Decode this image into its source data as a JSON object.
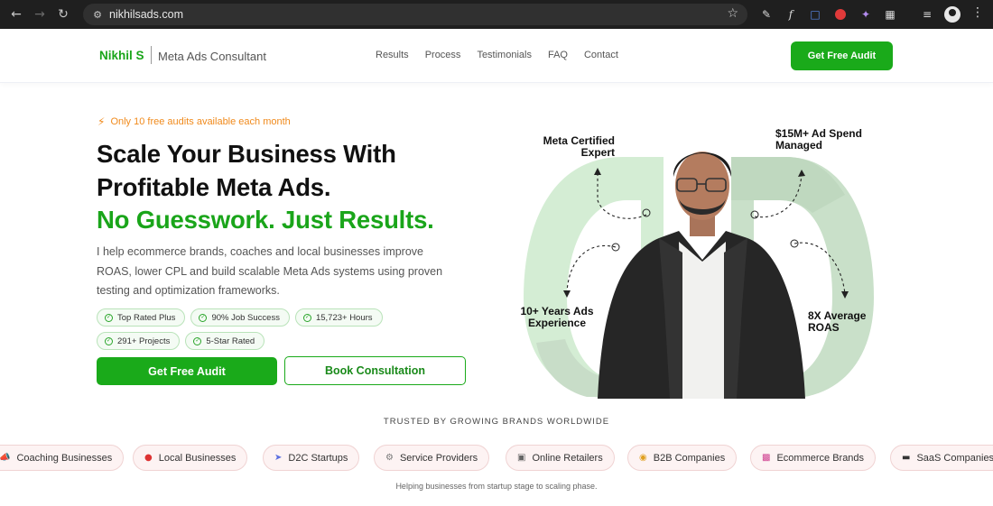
{
  "browser": {
    "url": "nikhilsads.com"
  },
  "nav": {
    "brand_name": "Nikhil S",
    "brand_tagline": "Meta Ads Consultant",
    "links": [
      "Results",
      "Process",
      "Testimonials",
      "FAQ",
      "Contact"
    ],
    "cta_label": "Get Free Audit"
  },
  "hero": {
    "promo": "Only 10 free audits available each month",
    "headline_line1": "Scale Your Business With",
    "headline_line2": "Profitable Meta Ads.",
    "headline_accent": "No Guesswork. Just Results.",
    "lead_line1": "I help ecommerce brands, coaches and local businesses improve",
    "lead_line2": "ROAS, lower CPL and build scalable Meta Ads systems using proven",
    "lead_line3": "testing and optimization frameworks.",
    "badges": [
      "Top Rated Plus",
      "90% Job Success",
      "15,723+ Hours",
      "291+ Projects",
      "5-Star Rated"
    ],
    "primary_cta": "Get Free Audit",
    "secondary_cta": "Book Consultation"
  },
  "callouts": {
    "certified_line1": "Meta Certified",
    "certified_line2": "Expert",
    "spend_line1": "$15M+ Ad Spend",
    "spend_line2": "Managed",
    "experience_line1": "10+ Years Ads",
    "experience_line2": "Experience",
    "roas_line1": "8X Average",
    "roas_line2": "ROAS"
  },
  "trust": {
    "title": "TRUSTED BY GROWING BRANDS WORLDWIDE",
    "chips": [
      {
        "label": "Coaching Businesses",
        "icon": "megaphone-icon"
      },
      {
        "label": "Local Businesses",
        "icon": "pin-icon"
      },
      {
        "label": "D2C Startups",
        "icon": "rocket-icon"
      },
      {
        "label": "Service Providers",
        "icon": "gear-icon"
      },
      {
        "label": "Online Retailers",
        "icon": "cart-icon"
      },
      {
        "label": "B2B Companies",
        "icon": "handshake-icon"
      },
      {
        "label": "Ecommerce Brands",
        "icon": "shopping-bag-icon"
      },
      {
        "label": "SaaS Companies",
        "icon": "laptop-icon"
      }
    ],
    "footnote": "Helping businesses from startup stage to scaling phase."
  },
  "colors": {
    "accent": "#1aaa1a",
    "promo": "#f08a1c",
    "ring_light": "#d4edd4",
    "ring_dark": "#c6dcc6"
  }
}
